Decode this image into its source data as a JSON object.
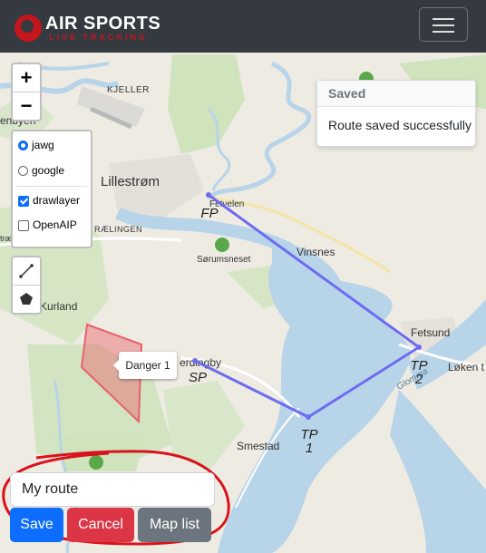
{
  "app": {
    "brand_title": "AIR SPORTS",
    "brand_subtitle": "LIVE TRACKING"
  },
  "navbar": {
    "menu_icon": "hamburger-icon"
  },
  "map": {
    "places": {
      "kjeller": "KJELLER",
      "lillestrom": "Lillestrøm",
      "fetvelen": "Fetvelen",
      "vinsnes": "Vinsnes",
      "sorumsneset": "Sørumsneset",
      "fetsund": "Fetsund",
      "loken": "Løken t",
      "kurland": "Kurland",
      "erdingby": "erdingby",
      "smestad": "Smestad",
      "ralingen": "RÆLINGEN",
      "glomma": "Glomma",
      "enbyen": "enbyen",
      "tra": "træ"
    },
    "waypoints": [
      {
        "name": "FP",
        "line1": "FP",
        "line2": ""
      },
      {
        "name": "SP",
        "line1": "SP",
        "line2": ""
      },
      {
        "name": "TP 1",
        "line1": "TP",
        "line2": "1"
      },
      {
        "name": "TP 2",
        "line1": "TP",
        "line2": "2"
      }
    ],
    "route_color": "#6d6cf0",
    "danger_area_color": "#e8616b"
  },
  "controls": {
    "zoom_in": "+",
    "zoom_out": "−",
    "layers": {
      "base": [
        {
          "label": "jawg",
          "selected": true
        },
        {
          "label": "google",
          "selected": false
        }
      ],
      "overlays": [
        {
          "label": "drawlayer",
          "checked": true
        },
        {
          "label": "OpenAIP",
          "checked": false
        }
      ]
    },
    "draw_tools": [
      "polyline-icon",
      "polygon-icon"
    ]
  },
  "toast": {
    "title": "Saved",
    "message": "Route saved successfully"
  },
  "tooltip": {
    "text": "Danger 1"
  },
  "form": {
    "route_name_value": "My route",
    "save_label": "Save",
    "cancel_label": "Cancel",
    "map_list_label": "Map list",
    "annotation_color": "#d9121b"
  }
}
